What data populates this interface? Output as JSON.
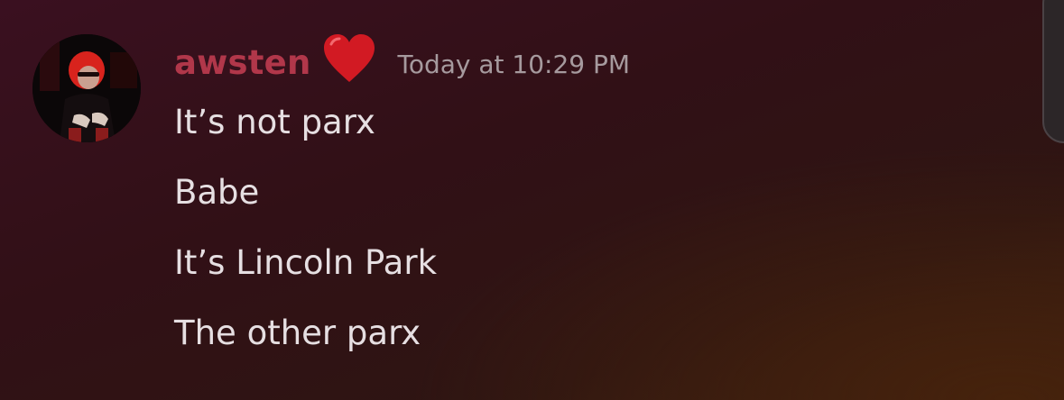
{
  "message": {
    "author": "awsten",
    "author_badge": "red-heart-icon",
    "timestamp": "Today at 10:29 PM",
    "lines": [
      "It’s not parx",
      "Babe",
      "It’s Lincoln Park",
      "The other parx"
    ]
  },
  "colors": {
    "username": "#b1374a",
    "timestamp": "#a69a9e",
    "message_text": "#e6dfe2",
    "heart": "#d21a23"
  }
}
